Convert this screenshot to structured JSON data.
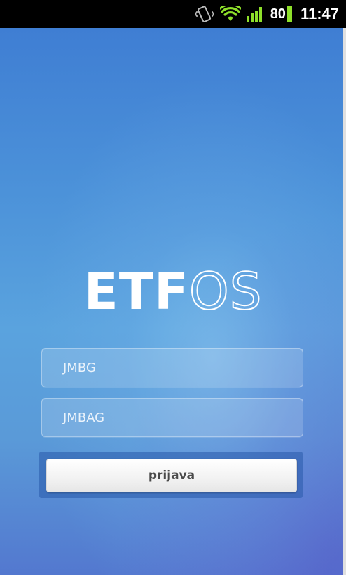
{
  "status_bar": {
    "battery_level": "80",
    "time": "11:47",
    "icons": [
      "vibrate-icon",
      "wifi-icon",
      "signal-icon",
      "battery-icon"
    ],
    "battery_color": "#8ee02a"
  },
  "app": {
    "logo_part1": "ETF",
    "logo_part2": "OS",
    "fields": {
      "jmbg_placeholder": "JMBG",
      "jmbag_placeholder": "JMBAG"
    },
    "login_label": "prijava",
    "colors": {
      "background_top": "#3f7ed3",
      "background_bottom": "#5378cf",
      "text": "#ffffff"
    }
  }
}
